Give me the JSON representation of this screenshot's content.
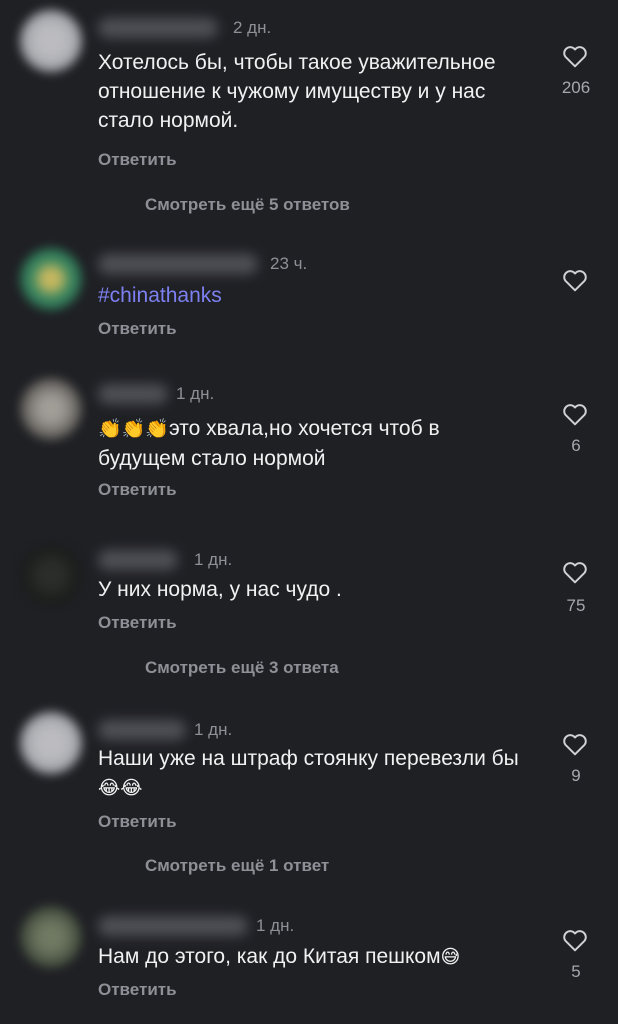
{
  "comments": [
    {
      "time": "2 дн.",
      "text": "Хотелось бы, чтобы такое уважительное отношение к чужому имуществу и у нас стало нормой.",
      "reply_label": "Ответить",
      "likes": "206",
      "more_replies": "Смотреть ещё 5 ответов"
    },
    {
      "time": "23 ч.",
      "text": "#chinathanks",
      "reply_label": "Ответить",
      "likes": ""
    },
    {
      "time": "1 дн.",
      "emoji": "👏👏👏",
      "text": "это хвала,но хочется чтоб в будущем стало нормой",
      "reply_label": "Ответить",
      "likes": "6"
    },
    {
      "time": "1 дн.",
      "text": "У них норма, у нас чудо .",
      "reply_label": "Ответить",
      "likes": "75",
      "more_replies": "Смотреть ещё 3 ответа"
    },
    {
      "time": "1 дн.",
      "text": "Наши уже на штраф стоянку перевезли бы",
      "emoji": "😂😂",
      "reply_label": "Ответить",
      "likes": "9",
      "more_replies": "Смотреть ещё 1 ответ"
    },
    {
      "time": "1 дн.",
      "text": "Нам до этого, как до Китая пешком",
      "emoji": "😅",
      "reply_label": "Ответить",
      "likes": "5"
    }
  ],
  "colors": {
    "background": "#1f2024",
    "hashtag": "#7d80f0",
    "muted": "#8e9097"
  }
}
